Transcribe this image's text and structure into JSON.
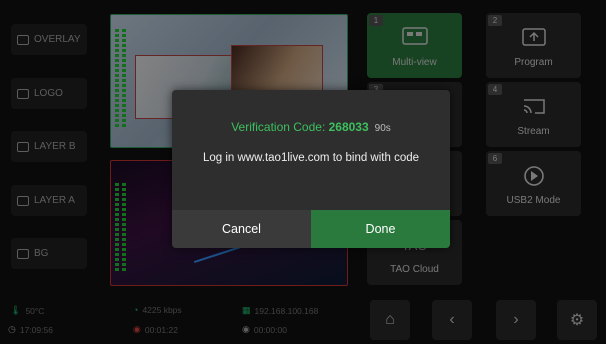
{
  "left_panel": {
    "items": [
      {
        "label": "OVERLAY",
        "icon": "monitor-icon"
      },
      {
        "label": "LOGO",
        "icon": "logo-icon"
      },
      {
        "label": "LAYER B",
        "icon": "layers-icon"
      },
      {
        "label": "LAYER A",
        "icon": "layers-icon"
      },
      {
        "label": "BG",
        "icon": "image-icon"
      }
    ]
  },
  "status": {
    "temperature": "50°C",
    "time": "17:09:56",
    "bitrate": "4225 kbps",
    "record_time": "00:01:22",
    "ip": "192.168.100.168",
    "stream_time": "00:00:00"
  },
  "tiles": [
    {
      "num": "1",
      "label": "Multi-view",
      "icon": "multiview-icon"
    },
    {
      "num": "2",
      "label": "Program",
      "icon": "program-icon"
    },
    {
      "num": "3",
      "label": "",
      "icon": ""
    },
    {
      "num": "4",
      "label": "Stream",
      "icon": "cast-icon"
    },
    {
      "num": "",
      "label": "",
      "icon": ""
    },
    {
      "num": "6",
      "label": "USB2 Mode",
      "icon": "play-circle-icon"
    },
    {
      "num": "",
      "label": "TAO Cloud",
      "icon": "tao-logo-icon",
      "logo_text": "TAO"
    }
  ],
  "modal": {
    "code_prefix": "Verification Code: ",
    "code": "268033",
    "seconds": "90s",
    "message": "Log in www.tao1live.com to bind with code",
    "cancel_label": "Cancel",
    "done_label": "Done"
  },
  "colors": {
    "accent": "#2a7a3e",
    "code_green": "#3cc05e"
  }
}
